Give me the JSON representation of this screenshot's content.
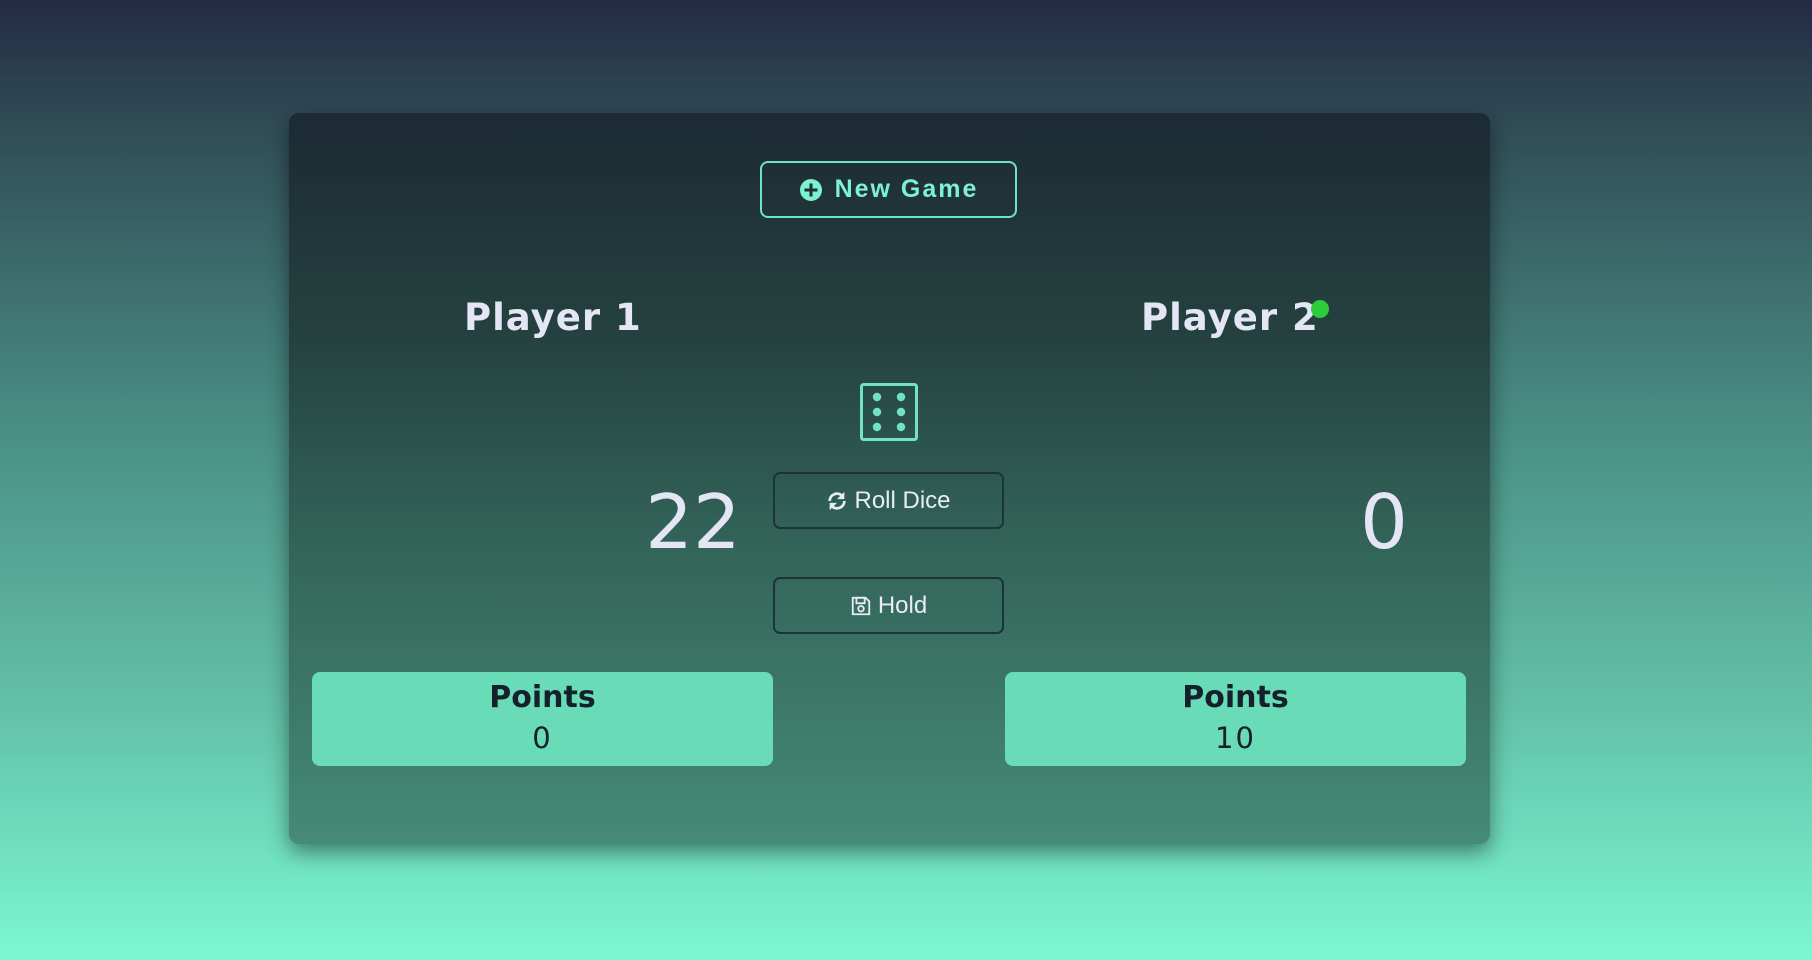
{
  "controls": {
    "new_game_label": "New Game",
    "roll_label": "Roll Dice",
    "hold_label": "Hold"
  },
  "icons": {
    "new_game": "plus-circle-icon",
    "dice": "dice-six-icon",
    "roll": "refresh-icon",
    "hold": "save-icon"
  },
  "dice": {
    "value": 6
  },
  "players": [
    {
      "name": "Player 1",
      "score": "22",
      "points_label": "Points",
      "points": "0",
      "active": false
    },
    {
      "name": "Player 2",
      "score": "0",
      "points_label": "Points",
      "points": "10",
      "active": true
    }
  ],
  "colors": {
    "accent": "#6fe3c2",
    "points_bg": "#69dbb7",
    "active_indicator": "#2ecb3a",
    "text_light": "#e4e6f6",
    "text_dark": "#14202c"
  }
}
